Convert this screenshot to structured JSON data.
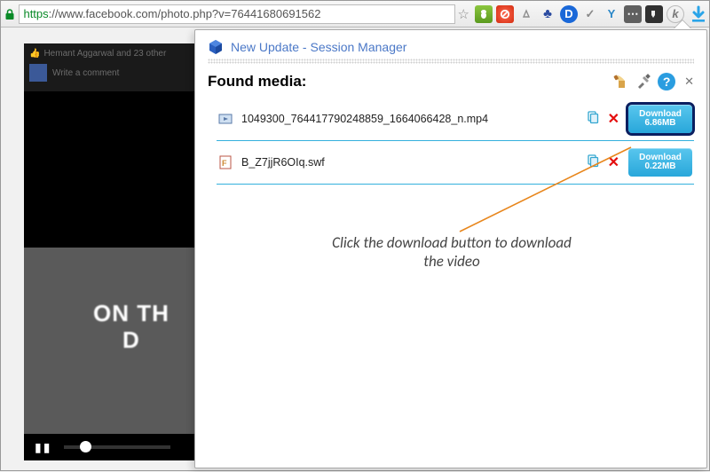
{
  "address": {
    "https": "https",
    "rest": "://www.facebook.com/photo.php?v=76441680691562"
  },
  "popup": {
    "update": "New Update - Session Manager",
    "found_label": "Found media:",
    "media": [
      {
        "icon": "video",
        "filename": "1049300_764417790248859_1664066428_n.mp4",
        "download_label": "Download",
        "size": "6.86MB"
      },
      {
        "icon": "flash",
        "filename": "B_Z7jjR6OIq.swf",
        "download_label": "Download",
        "size": "0.22MB"
      }
    ]
  },
  "video": {
    "line1": "ON TH",
    "line2": "D",
    "faded1": "",
    "faded2": ""
  },
  "fb": {
    "like_line": "Hemant Aggarwal and 23 other",
    "comment_placeholder": "Write a comment"
  },
  "annotation": "Click the download button to download the video"
}
